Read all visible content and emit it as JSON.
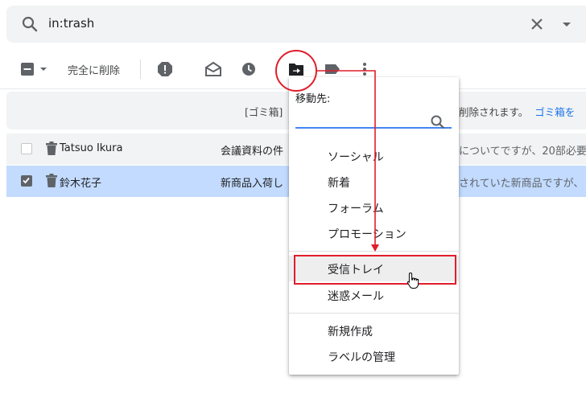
{
  "search": {
    "query": "in:trash",
    "icons": {
      "search": "search-icon",
      "clear": "close-icon",
      "options": "caret-down-icon"
    }
  },
  "toolbar": {
    "delete_forever_label": "完全に削除",
    "icons": [
      "select-checkbox-icon",
      "caret-down-icon",
      "report-spam-icon",
      "mark-as-read-icon",
      "snooze-icon",
      "move-to-icon",
      "label-icon",
      "more-vert-icon"
    ]
  },
  "notice": {
    "text_left": "[ゴミ箱]",
    "text_right": "削除されます。",
    "link": "ゴミ箱を"
  },
  "emails": [
    {
      "sender": "Tatsuo Ikura",
      "subject": "会議資料の件",
      "snippet": "についてですが、20部必要",
      "checked": false
    },
    {
      "sender": "鈴木花子",
      "subject": "新商品入荷し",
      "snippet": "されていた新商品ですが、",
      "checked": true
    }
  ],
  "move_menu": {
    "title": "移動先:",
    "search_placeholder": "",
    "items_group1": [
      "ソーシャル",
      "新着",
      "フォーラム",
      "プロモーション"
    ],
    "items_group2": [
      "受信トレイ",
      "迷惑メール"
    ],
    "items_group3": [
      "新規作成",
      "ラベルの管理"
    ],
    "highlighted_item": "受信トレイ"
  },
  "colors": {
    "accent_blue": "#1a73e8",
    "selected_row": "#c2dbff",
    "annotation_red": "#e11d2a"
  }
}
